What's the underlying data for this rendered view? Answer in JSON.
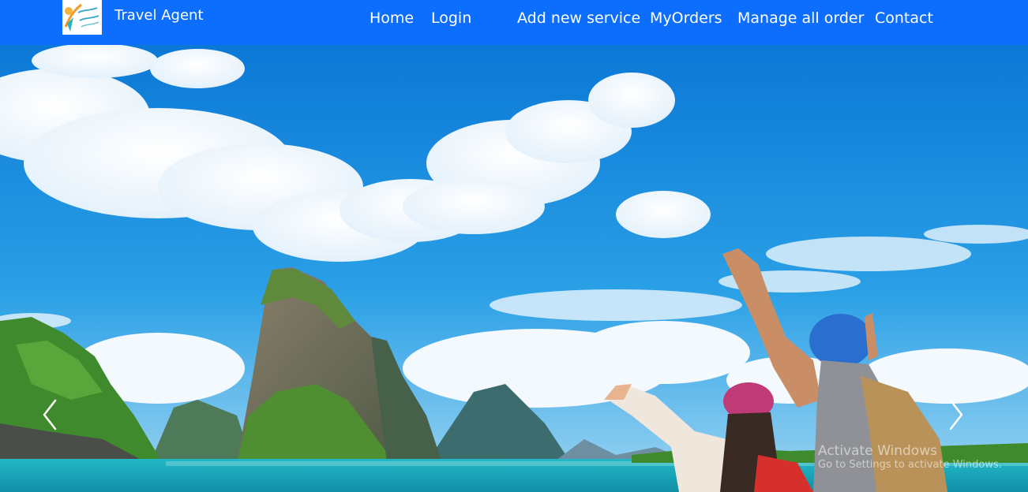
{
  "brand": {
    "name": "Travel Agent",
    "logo_icon": "travel-agent-logo"
  },
  "nav": {
    "home": "Home",
    "login": "Login",
    "add_service": "Add new service",
    "my_orders": "MyOrders",
    "manage_orders": "Manage all order",
    "contact": "Contact"
  },
  "hero": {
    "image": "tropical-island-travelers-banner",
    "prev_icon": "chevron-left-icon",
    "next_icon": "chevron-right-icon"
  },
  "watermark": {
    "title": "Activate Windows",
    "subtitle": "Go to Settings to activate Windows."
  },
  "colors": {
    "navbar": "#0d6efd",
    "sky": "#1e8fe0",
    "sea": "#1fb2c2"
  }
}
